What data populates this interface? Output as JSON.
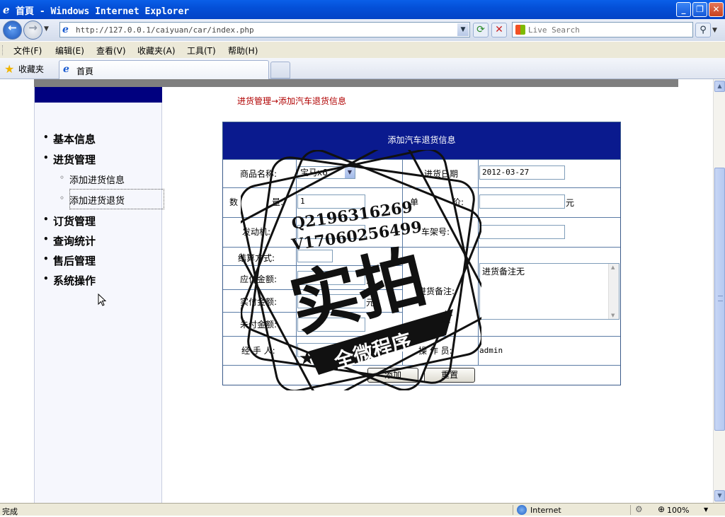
{
  "window": {
    "title": "首頁 - Windows Internet Explorer"
  },
  "address": {
    "url": "http://127.0.0.1/caiyuan/car/index.php"
  },
  "search": {
    "placeholder": "Live Search"
  },
  "menu": [
    "文件(F)",
    "编辑(E)",
    "查看(V)",
    "收藏夹(A)",
    "工具(T)",
    "帮助(H)"
  ],
  "favorites": {
    "label": "收藏夹"
  },
  "tab": {
    "title": "首頁"
  },
  "sidebar": {
    "items": [
      "基本信息",
      "进货管理",
      "订货管理",
      "查询统计",
      "售后管理",
      "系统操作"
    ],
    "subitems": [
      "添加进货信息",
      "添加进货退货"
    ]
  },
  "breadcrumb": "进货管理→添加汽车退货信息",
  "form": {
    "title": "添加汽车退货信息",
    "product_label": "商品名称:",
    "product_value": "宝马x6",
    "date_label": "进货日期",
    "date_value": "2012-03-27",
    "qty_label_a": "数",
    "qty_label_b": "量:",
    "qty_value": "1",
    "price_label_a": "单",
    "price_label_b": "价:",
    "price_unit": "元",
    "engine_label": "发动机:",
    "frame_label": "车架号:",
    "settle_label": "结算方式:",
    "payable_label": "应付金额:",
    "payable_unit": "元",
    "paid_label": "实付金额:",
    "paid_unit": "元",
    "unpaid_label": "未付金额:",
    "remark_label": "进货备注:",
    "remark_value": "进货备注无",
    "handler_label": "经 手 人:",
    "operator_label": "操 作 员:",
    "operator_value": "admin",
    "submit_label": "添加",
    "reset_label": "重置"
  },
  "watermark": {
    "line1": "Q2196316269",
    "line2": "V17060256499",
    "main": "实拍",
    "banner": "全微程序"
  },
  "status": {
    "text": "完成",
    "zone": "Internet",
    "zoom": "100%"
  }
}
